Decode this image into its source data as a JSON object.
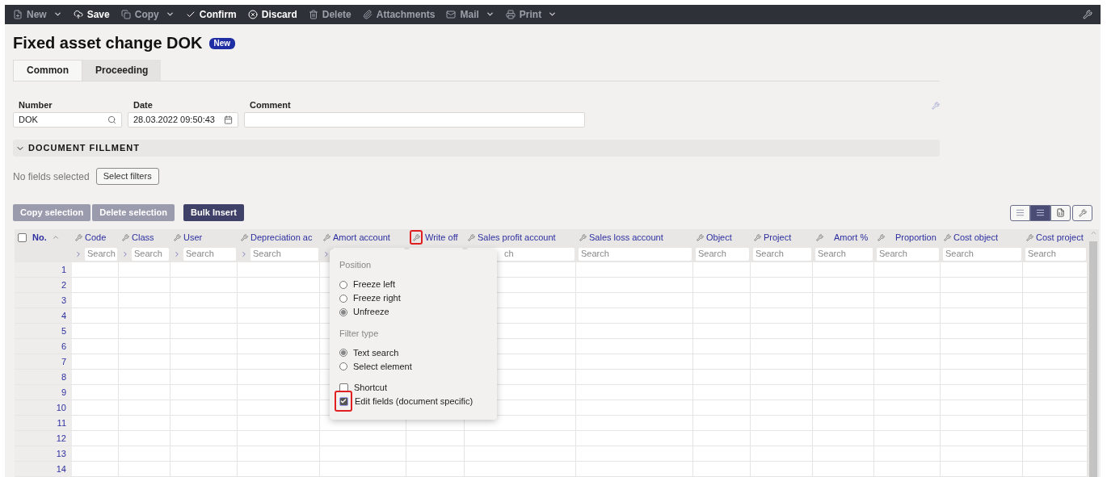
{
  "toolbar": {
    "items": [
      {
        "kind": "new",
        "label": "New",
        "disabled": true,
        "dropdown": true
      },
      {
        "kind": "save",
        "label": "Save",
        "disabled": false,
        "dropdown": false
      },
      {
        "kind": "copy",
        "label": "Copy",
        "disabled": true,
        "dropdown": true
      },
      {
        "kind": "confirm",
        "label": "Confirm",
        "disabled": false,
        "dropdown": false
      },
      {
        "kind": "discard",
        "label": "Discard",
        "disabled": false,
        "dropdown": false
      },
      {
        "kind": "delete",
        "label": "Delete",
        "disabled": true,
        "dropdown": false
      },
      {
        "kind": "attach",
        "label": "Attachments",
        "disabled": true,
        "dropdown": false
      },
      {
        "kind": "mail",
        "label": "Mail",
        "disabled": true,
        "dropdown": true
      },
      {
        "kind": "print",
        "label": "Print",
        "disabled": true,
        "dropdown": true
      }
    ]
  },
  "title": "Fixed asset change DOK",
  "status_badge": "New",
  "tabs": [
    {
      "label": "Common",
      "selected": true
    },
    {
      "label": "Proceeding",
      "selected": false
    }
  ],
  "fields": [
    {
      "kind": "search",
      "label": "Number",
      "value": "DOK"
    },
    {
      "kind": "date",
      "label": "Date",
      "value": "28.03.2022 09:50:43"
    },
    {
      "kind": "text",
      "label": "Comment"
    }
  ],
  "section": {
    "title": "DOCUMENT FILLMENT",
    "expanded": true
  },
  "filters": {
    "text": "No fields selected",
    "button": "Select filters"
  },
  "actions": [
    {
      "label": "Copy selection",
      "disabled": true
    },
    {
      "label": "Delete selection",
      "disabled": true
    },
    {
      "label": "Bulk Insert",
      "disabled": false
    }
  ],
  "view_buttons": [
    {
      "kind": "list",
      "selected": false
    },
    {
      "kind": "list",
      "selected": true
    },
    {
      "kind": "excel",
      "selected": false
    },
    {
      "kind": "settings",
      "selected": false
    }
  ],
  "table": {
    "columns": [
      {
        "label": "No.",
        "kind": "number",
        "select_all_checked": false
      },
      {
        "label": "Code",
        "highlighted": false,
        "filter": {
          "chevron": true,
          "placeholder": "Search"
        }
      },
      {
        "label": "Class",
        "highlighted": false,
        "filter": {
          "chevron": true,
          "placeholder": "Search"
        }
      },
      {
        "label": "User",
        "highlighted": false,
        "filter": {
          "chevron": true,
          "placeholder": "Search"
        }
      },
      {
        "label": "Depreciation ac",
        "highlighted": false,
        "filter": {
          "chevron": true,
          "placeholder": "Search"
        }
      },
      {
        "label": "Amort account",
        "highlighted": false,
        "filter": {
          "chevron": true
        }
      },
      {
        "label": "Write off",
        "highlighted": true,
        "filter": {
          "chevron": false
        }
      },
      {
        "label": "Sales profit account",
        "highlighted": false,
        "filter": {
          "chevron": false,
          "covered": true,
          "placeholder": "ch"
        }
      },
      {
        "label": "Sales loss account",
        "highlighted": false,
        "filter": {
          "chevron": false,
          "placeholder": "Search"
        }
      },
      {
        "label": "Object",
        "highlighted": false,
        "filter": {
          "chevron": false,
          "placeholder": "Search"
        }
      },
      {
        "label": "Project",
        "highlighted": false,
        "filter": {
          "chevron": false,
          "placeholder": "Search"
        }
      },
      {
        "label": "Amort %",
        "highlighted": false,
        "filter": {
          "chevron": false,
          "placeholder": "Search"
        }
      },
      {
        "label": "Proportion",
        "highlighted": false,
        "filter": {
          "chevron": false,
          "placeholder": "Search"
        }
      },
      {
        "label": "Cost object",
        "highlighted": false,
        "filter": {
          "chevron": false,
          "placeholder": "Search"
        }
      },
      {
        "label": "Cost project",
        "highlighted": false,
        "filter": {
          "chevron": false,
          "placeholder": "Search"
        }
      }
    ],
    "rows": [
      "1",
      "2",
      "3",
      "4",
      "5",
      "6",
      "7",
      "8",
      "9",
      "10",
      "11",
      "12",
      "13",
      "14"
    ]
  },
  "column_menu": {
    "sections": [
      {
        "heading": "Position",
        "options": [
          {
            "kind": "radio",
            "label": "Freeze left",
            "selected": false
          },
          {
            "kind": "radio",
            "label": "Freeze right",
            "selected": false
          },
          {
            "kind": "radio",
            "label": "Unfreeze",
            "selected": true
          }
        ]
      },
      {
        "heading": "Filter type",
        "options": [
          {
            "kind": "radio",
            "label": "Text search",
            "selected": true
          },
          {
            "kind": "radio",
            "label": "Select element",
            "selected": false
          }
        ]
      },
      {
        "options": [
          {
            "kind": "checkbox",
            "label": "Shortcut",
            "checked": false,
            "highlighted": false
          },
          {
            "kind": "checkbox",
            "label": "Edit fields (document specific)",
            "checked": true,
            "highlighted": true
          }
        ]
      }
    ]
  }
}
